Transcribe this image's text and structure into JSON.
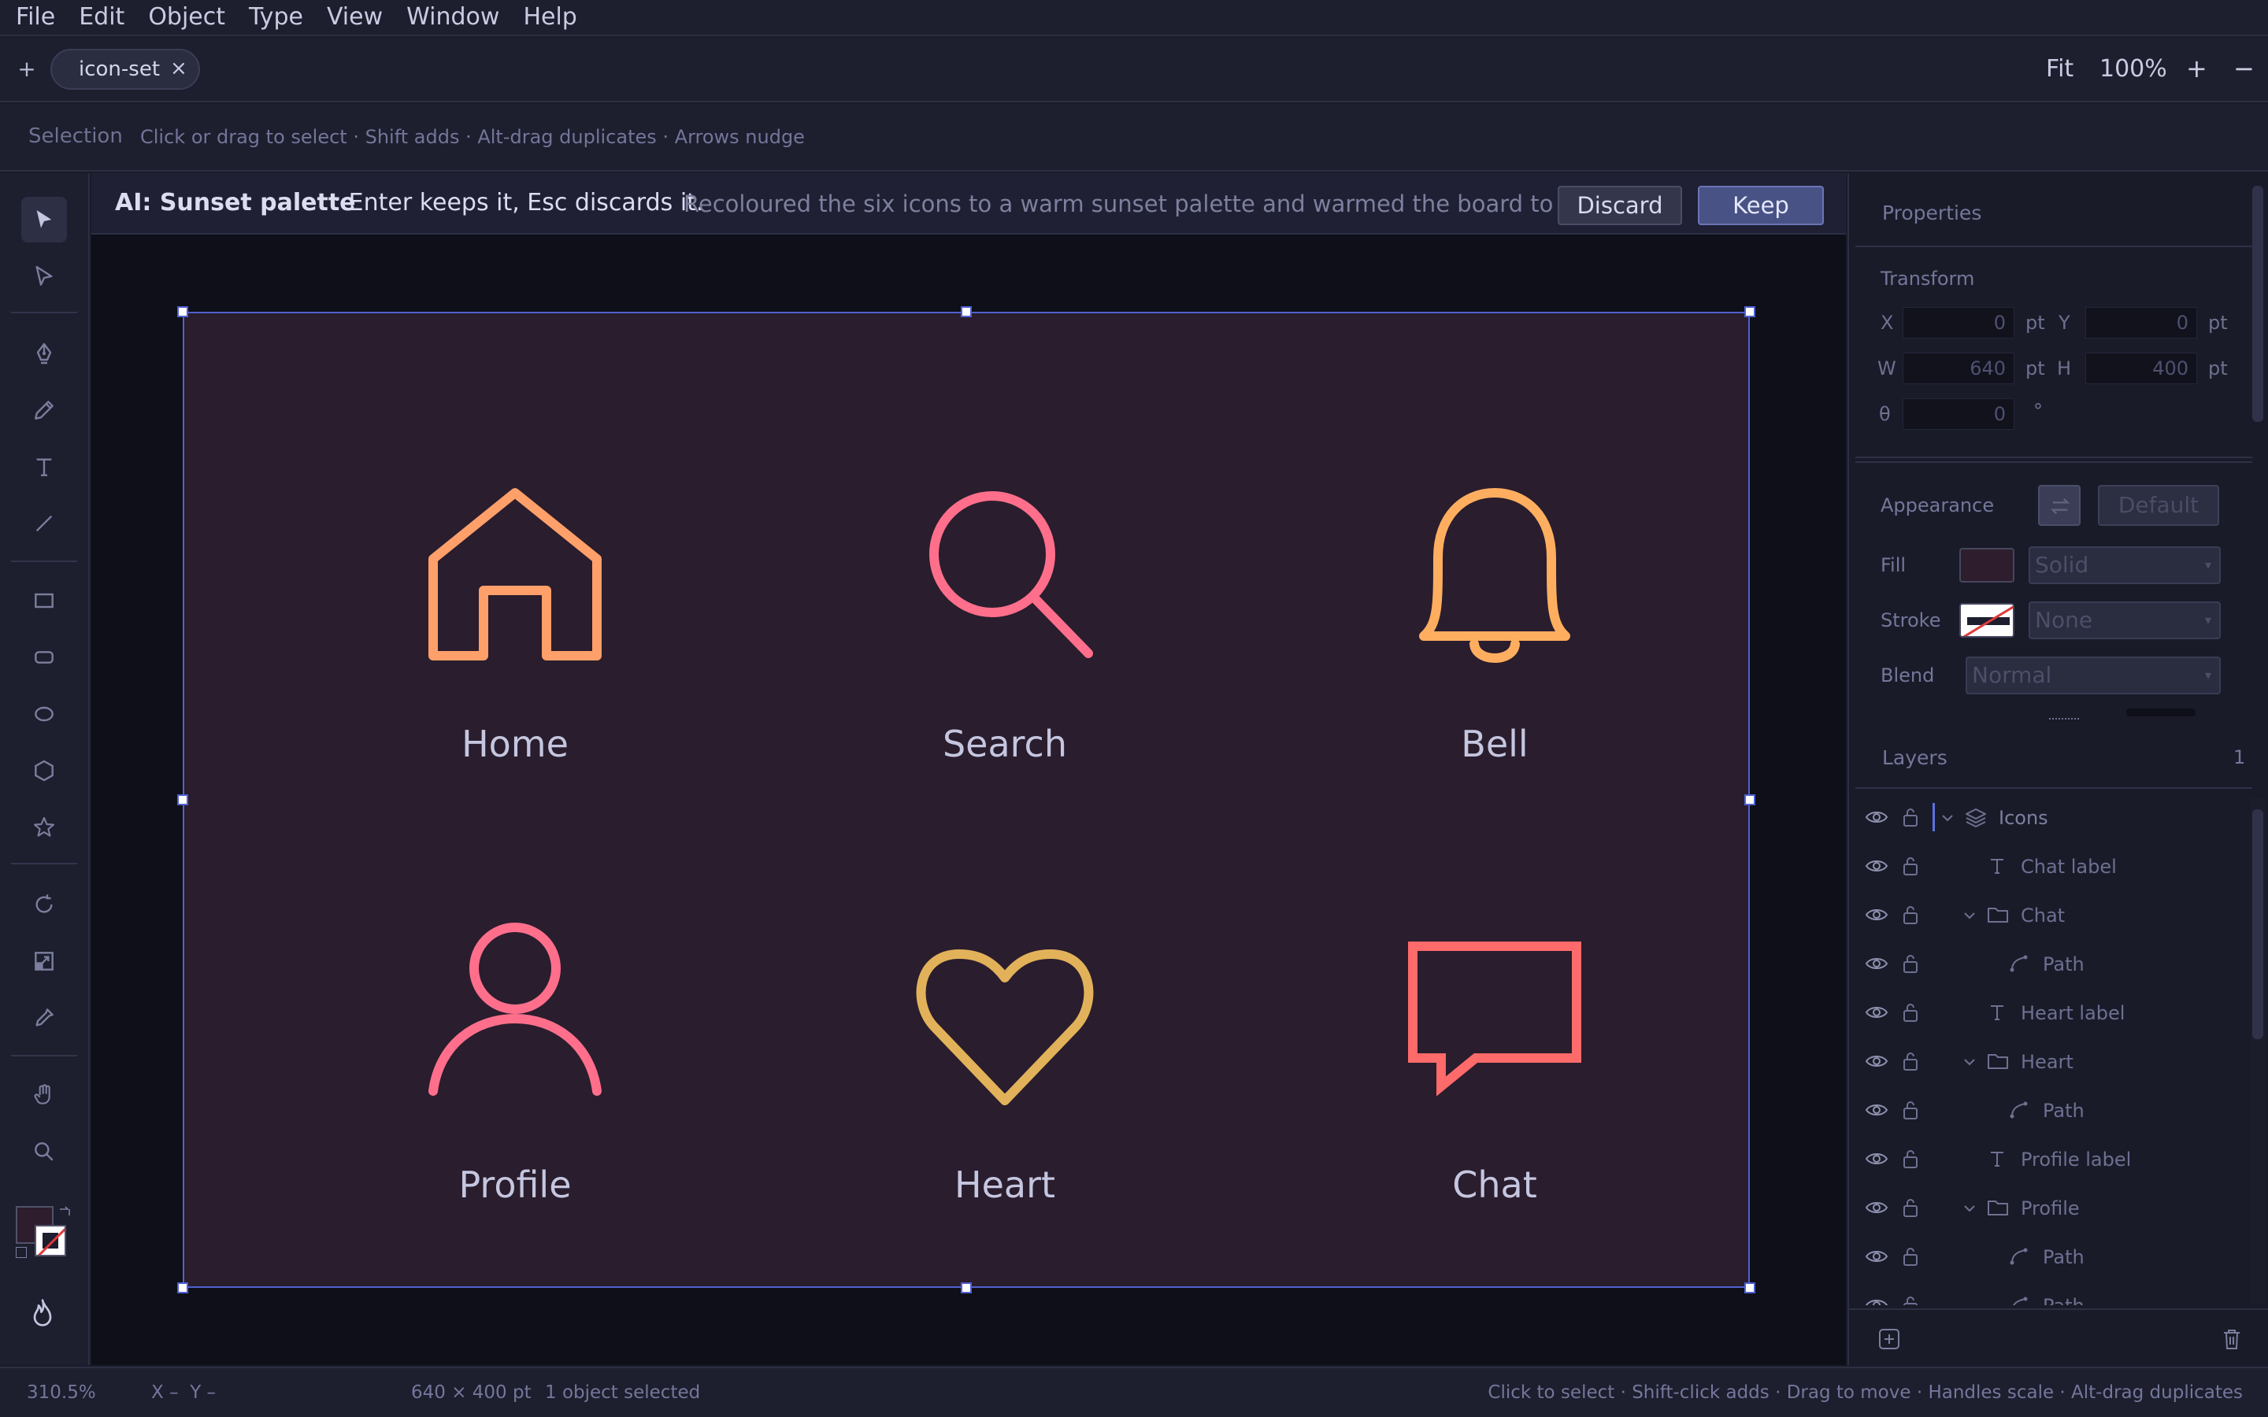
{
  "menu": [
    "File",
    "Edit",
    "Object",
    "Type",
    "View",
    "Window",
    "Help"
  ],
  "tabs": {
    "new_label": "+",
    "document": "icon-set",
    "close_label": "×"
  },
  "zoom": {
    "fit": "Fit",
    "level": "100%",
    "in": "+",
    "out": "−"
  },
  "hint": {
    "tool": "Selection",
    "text": "Click or drag to select · Shift adds · Alt-drag duplicates · Arrows nudge"
  },
  "toolbar": {
    "tools": [
      "selection-tool",
      "direct-selection-tool",
      "pen-tool",
      "pencil-tool",
      "type-tool",
      "line-tool",
      "rectangle-tool",
      "rounded-rectangle-tool",
      "ellipse-tool",
      "polygon-tool",
      "star-tool",
      "rotate-tool",
      "scale-tool",
      "eyedropper-tool",
      "hand-tool",
      "zoom-tool"
    ],
    "active": "selection-tool",
    "fill_color": "#2e1d2c",
    "stroke_color": "none"
  },
  "ai_banner": {
    "title": "AI: Sunset palette",
    "instruction": ": Enter keeps it, Esc discards it.",
    "description": "Recoloured the six icons to a warm sunset palette and warmed the board to r",
    "discard_label": "Discard",
    "keep_label": "Keep"
  },
  "artboard": {
    "background": "#2a1d2d",
    "icons": [
      {
        "name": "home-icon",
        "label": "Home",
        "color": "#ffa06a"
      },
      {
        "name": "search-icon",
        "label": "Search",
        "color": "#ff6f8c"
      },
      {
        "name": "bell-icon",
        "label": "Bell",
        "color": "#ffae60"
      },
      {
        "name": "profile-icon",
        "label": "Profile",
        "color": "#ff6f8c"
      },
      {
        "name": "heart-icon",
        "label": "Heart",
        "color": "#e2b25a"
      },
      {
        "name": "chat-icon",
        "label": "Chat",
        "color": "#ff6a6a"
      }
    ]
  },
  "properties": {
    "header": "Properties",
    "transform_title": "Transform",
    "x_label": "X",
    "x_value": "0",
    "y_label": "Y",
    "y_value": "0",
    "w_label": "W",
    "w_value": "640",
    "h_label": "H",
    "h_value": "400",
    "rotation_label": "θ",
    "rotation_value": "0",
    "unit": "pt",
    "degree_unit": "°",
    "appearance_title": "Appearance",
    "default_label": "Default",
    "fill_label": "Fill",
    "fill_mode": "Solid",
    "stroke_label": "Stroke",
    "stroke_mode": "None",
    "blend_label": "Blend",
    "blend_mode": "Normal"
  },
  "layers": {
    "title": "Layers",
    "count": "1",
    "items": [
      {
        "name": "Icons",
        "type": "layer",
        "depth": 0,
        "expanded": true
      },
      {
        "name": "Chat label",
        "type": "text",
        "depth": 1
      },
      {
        "name": "Chat",
        "type": "group",
        "depth": 1,
        "expanded": true
      },
      {
        "name": "Path",
        "type": "path",
        "depth": 2
      },
      {
        "name": "Heart label",
        "type": "text",
        "depth": 1
      },
      {
        "name": "Heart",
        "type": "group",
        "depth": 1,
        "expanded": true
      },
      {
        "name": "Path",
        "type": "path",
        "depth": 2
      },
      {
        "name": "Profile label",
        "type": "text",
        "depth": 1
      },
      {
        "name": "Profile",
        "type": "group",
        "depth": 1,
        "expanded": true
      },
      {
        "name": "Path",
        "type": "path",
        "depth": 2
      },
      {
        "name": "Path",
        "type": "path",
        "depth": 2
      }
    ]
  },
  "status": {
    "zoom": "310.5%",
    "cursor": "X –  Y –",
    "dimensions": "640 × 400 pt",
    "selection": "1 object selected",
    "hint": "Click to select · Shift-click adds · Drag to move · Handles scale · Alt-drag duplicates"
  }
}
